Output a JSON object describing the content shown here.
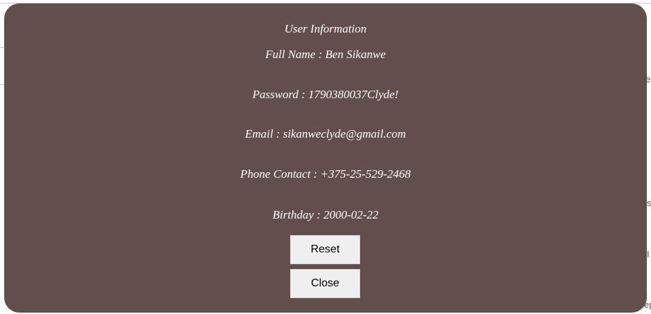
{
  "background": {
    "right_edge_fragments": [
      "e",
      "s",
      "I",
      "ep"
    ]
  },
  "modal": {
    "title": "User Information",
    "rows": [
      {
        "label": "Full Name",
        "separator": " : ",
        "value": "Ben Sikanwe",
        "text": "Full Name : Ben Sikanwe"
      },
      {
        "label": "Password",
        "separator": " : ",
        "value": "1790380037Clyde!",
        "text": "Password : 1790380037Clyde!"
      },
      {
        "label": "Email",
        "separator": " : ",
        "value": "sikanweclyde@gmail.com",
        "text": "Email : sikanweclyde@gmail.com"
      },
      {
        "label": "Phone Contact",
        "separator": " : ",
        "value": "+375-25-529-2468",
        "text": "Phone Contact : +375-25-529-2468"
      },
      {
        "label": "Birthday",
        "separator": " : ",
        "value": "2000-02-22",
        "text": "Birthday : 2000-02-22"
      }
    ],
    "buttons": {
      "reset_label": "Reset",
      "close_label": "Close"
    },
    "colors": {
      "modal_background": "#624e4b",
      "text": "#ffffff",
      "button_background": "#efefef"
    }
  }
}
